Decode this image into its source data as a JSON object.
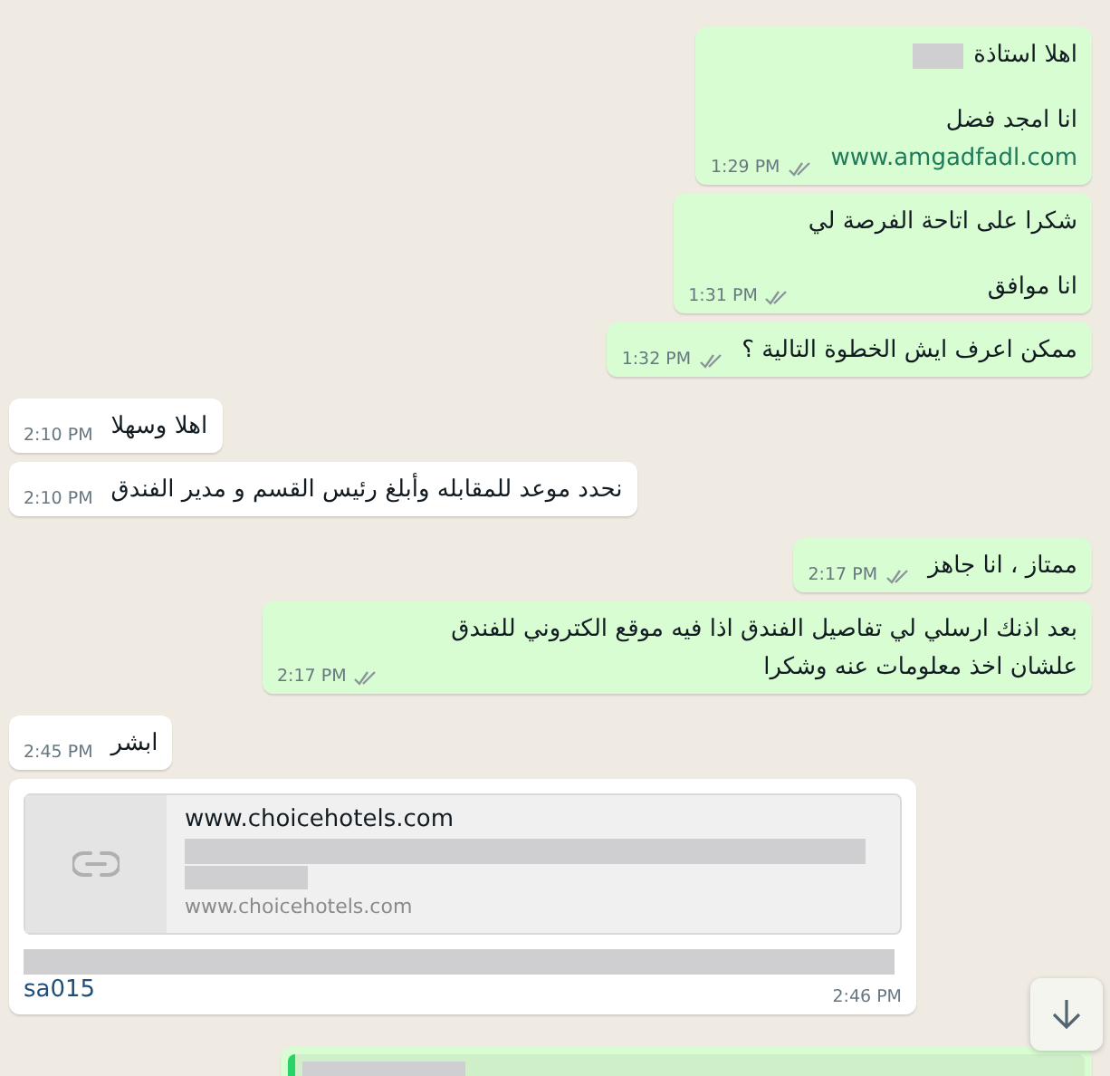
{
  "messages": [
    {
      "kind": "text",
      "outgoing": true,
      "time": "1:29 PM",
      "read": false,
      "paragraphs": [
        [
          [
            {
              "kind": "text",
              "text": "اهلا استاذة"
            },
            {
              "kind": "redacted"
            }
          ]
        ],
        [
          [
            {
              "kind": "text",
              "text": "انا امجد فضل"
            }
          ],
          [
            {
              "kind": "link",
              "text": "www.amgadfadl.com"
            }
          ]
        ]
      ]
    },
    {
      "kind": "text",
      "outgoing": true,
      "time": "1:31 PM",
      "read": false,
      "paragraphs": [
        [
          [
            {
              "kind": "text",
              "text": "شكرا على اتاحة الفرصة لي"
            }
          ]
        ],
        [
          [
            {
              "kind": "text",
              "text": "انا موافق"
            }
          ]
        ]
      ]
    },
    {
      "kind": "text",
      "outgoing": true,
      "time": "1:32 PM",
      "read": false,
      "paragraphs": [
        [
          [
            {
              "kind": "text",
              "text": "ممكن اعرف ايش الخطوة التالية ؟"
            }
          ]
        ]
      ]
    },
    {
      "kind": "text",
      "outgoing": false,
      "time": "2:10 PM",
      "paragraphs": [
        [
          [
            {
              "kind": "text",
              "text": "اهلا وسهلا"
            }
          ]
        ]
      ]
    },
    {
      "kind": "text",
      "outgoing": false,
      "time": "2:10 PM",
      "paragraphs": [
        [
          [
            {
              "kind": "text",
              "text": "نحدد موعد للمقابله وأبلغ رئيس القسم و مدير الفندق"
            }
          ]
        ]
      ]
    },
    {
      "kind": "text",
      "outgoing": true,
      "time": "2:17 PM",
      "read": false,
      "paragraphs": [
        [
          [
            {
              "kind": "text",
              "text": "ممتاز ، انا جاهز"
            }
          ]
        ]
      ]
    },
    {
      "kind": "text",
      "outgoing": true,
      "time": "2:17 PM",
      "read": false,
      "paragraphs": [
        [
          [
            {
              "kind": "text",
              "text": "بعد اذنك ارسلي لي تفاصيل الفندق اذا فيه موقع الكتروني للفندق علشان اخذ معلومات عنه وشكرا"
            }
          ]
        ]
      ]
    },
    {
      "kind": "text",
      "outgoing": false,
      "time": "2:45 PM",
      "paragraphs": [
        [
          [
            {
              "kind": "text",
              "text": "ابشر"
            }
          ]
        ]
      ]
    },
    {
      "kind": "link_preview",
      "outgoing": false,
      "time": "2:46 PM",
      "preview": {
        "title": "www.choicehotels.com",
        "domain": "www.choicehotels.com"
      },
      "link": "sa015"
    },
    {
      "kind": "quote",
      "outgoing": true
    }
  ]
}
